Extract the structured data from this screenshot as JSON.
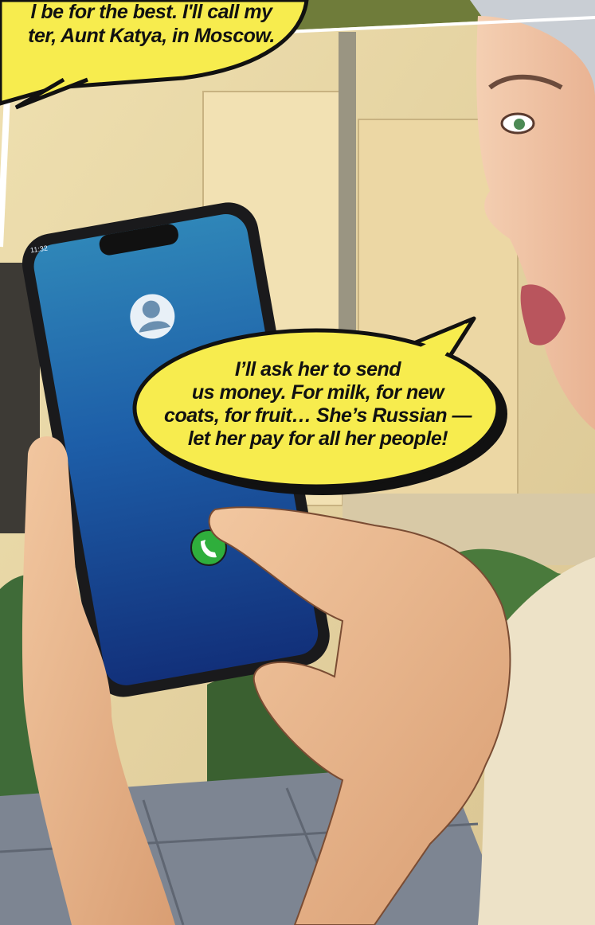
{
  "top_bubble": {
    "lines": [
      "l be for the best. I'll call my",
      "ter, Aunt Katya, in Moscow."
    ]
  },
  "main_bubble": {
    "lines": [
      "I’ll ask her to send",
      "us money. For milk, for new",
      "coats, for fruit… She’s Russian —",
      "let her pay for all her people!"
    ]
  },
  "phone": {
    "status_time": "11:32",
    "avatar_icon": "person-avatar-icon",
    "call_icon": "phone-call-icon",
    "call_color": "#2fae3c"
  },
  "colors": {
    "bubble_fill": "#f7ec4e",
    "bubble_outline": "#111111",
    "wall": "#e9d8a6",
    "screen": "#1f64a8"
  }
}
